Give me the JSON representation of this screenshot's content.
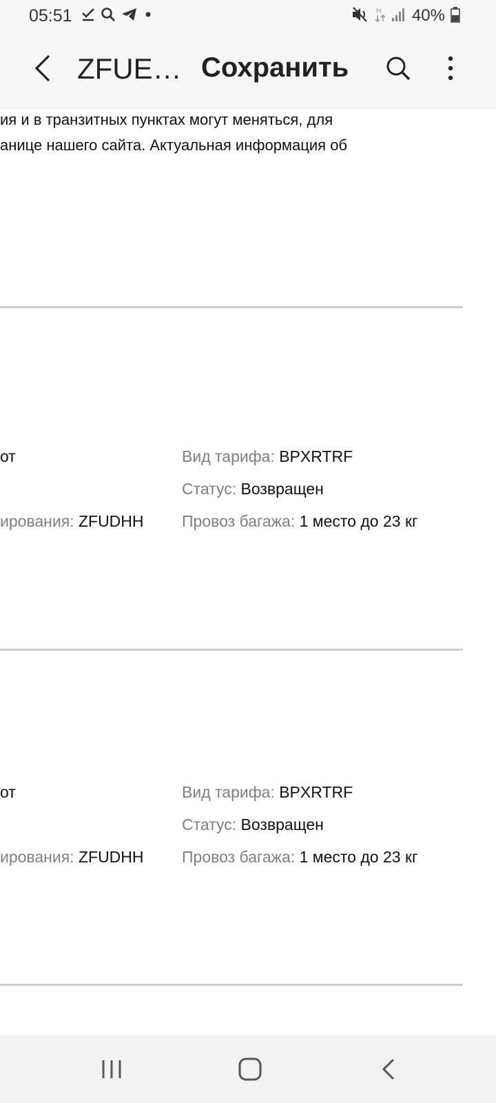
{
  "status_bar": {
    "time": "05:51",
    "battery": "40%",
    "left_icons": [
      "check-icon",
      "search-icon",
      "telegram-icon",
      "dot-icon"
    ],
    "right_icons": [
      "mute-icon",
      "data-arrows-icon",
      "signal-icon",
      "battery-icon"
    ]
  },
  "app_bar": {
    "title": "ZFUE…",
    "save_label": "Сохранить"
  },
  "notice": {
    "line1": "ия и в транзитных пунктах могут меняться, для",
    "line2": "анице нашего сайта. Актуальная информация об"
  },
  "tickets": [
    {
      "left_row1": "от",
      "left_row3_label": "ирования: ",
      "left_row3_value": "ZFUDHH",
      "fare_label": "Вид тарифа: ",
      "fare_value": "BPXRTRF",
      "status_label": "Статус: ",
      "status_value": "Возвращен",
      "baggage_label": "Провоз багажа: ",
      "baggage_value": "1 место до 23 кг"
    },
    {
      "left_row1": "от",
      "left_row3_label": "ирования: ",
      "left_row3_value": "ZFUDHH",
      "fare_label": "Вид тарифа: ",
      "fare_value": "BPXRTRF",
      "status_label": "Статус: ",
      "status_value": "Возвращен",
      "baggage_label": "Провоз багажа: ",
      "baggage_value": "1 место до 23 кг"
    }
  ],
  "nav_bar": {
    "icons": [
      "recent-apps-icon",
      "home-icon",
      "back-icon"
    ]
  }
}
